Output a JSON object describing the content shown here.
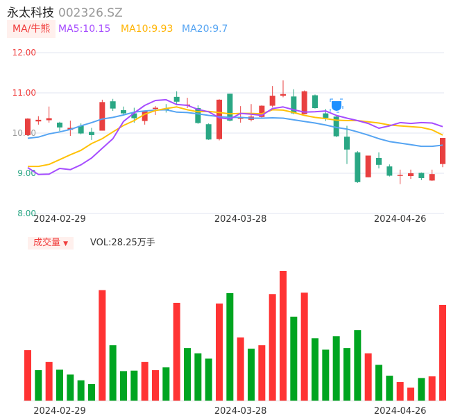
{
  "header": {
    "name": "永太科技",
    "code": "002326.SZ"
  },
  "ma_legend": {
    "tag": "MA/牛熊",
    "ma5": "MA5:10.15",
    "ma10": "MA10:9.93",
    "ma20": "MA20:9.7"
  },
  "volume_legend": {
    "tag": "成交量",
    "arrow": "▼",
    "value": "VOL:28.25万手"
  },
  "colors": {
    "up": "#e84040",
    "down": "#2aa784",
    "vol_up": "#ff3333",
    "vol_down": "#00a521",
    "ma5": "#a64dff",
    "ma10": "#ffc107",
    "ma20": "#55a4f2",
    "grid": "#e1e5f0"
  },
  "marker_icon": "bull-bear-shield-icon",
  "chart_data": {
    "type": "candlestick",
    "ylim": [
      8,
      12
    ],
    "y_ticks": [
      "12.00",
      "11.00",
      "10.00",
      "9.00",
      "8.00"
    ],
    "x_ticks": [
      {
        "index": 3,
        "label": "2024-02-29"
      },
      {
        "index": 20,
        "label": "2024-03-28"
      },
      {
        "index": 35,
        "label": "2024-04-26"
      }
    ],
    "candles": {
      "open": [
        9.95,
        10.29,
        10.32,
        10.26,
        10.08,
        10.18,
        10.03,
        10.06,
        10.79,
        10.57,
        10.49,
        10.3,
        10.6,
        10.61,
        10.9,
        10.68,
        10.62,
        10.22,
        9.85,
        10.98,
        10.36,
        10.33,
        10.4,
        10.68,
        10.93,
        10.91,
        10.47,
        10.94,
        10.49,
        10.41,
        9.91,
        9.52,
        8.9,
        9.38,
        9.17,
        8.94,
        8.93,
        9.01,
        8.82,
        9.23
      ],
      "close": [
        10.36,
        10.33,
        10.37,
        10.14,
        10.13,
        9.99,
        9.95,
        10.77,
        10.61,
        10.49,
        10.37,
        10.55,
        10.63,
        10.56,
        10.78,
        10.71,
        10.25,
        9.84,
        10.83,
        10.31,
        10.38,
        10.41,
        10.68,
        10.93,
        10.97,
        10.49,
        11.04,
        10.62,
        10.38,
        9.92,
        9.59,
        8.78,
        9.44,
        9.21,
        8.94,
        8.96,
        9.0,
        8.88,
        8.98,
        9.88
      ],
      "high": [
        10.37,
        10.42,
        10.66,
        10.28,
        10.31,
        10.24,
        10.13,
        10.83,
        10.85,
        10.66,
        10.63,
        10.55,
        10.67,
        10.72,
        11.04,
        10.88,
        10.69,
        10.24,
        10.84,
        10.98,
        10.67,
        10.72,
        10.69,
        11.17,
        11.31,
        11.09,
        11.06,
        10.96,
        10.6,
        10.42,
        10.18,
        9.55,
        9.44,
        9.52,
        9.22,
        9.09,
        9.09,
        9.02,
        9.09,
        9.88
      ],
      "low": [
        9.94,
        10.21,
        10.26,
        10.05,
        9.93,
        9.97,
        9.83,
        10.06,
        10.55,
        10.45,
        10.26,
        10.21,
        10.45,
        10.51,
        10.69,
        10.62,
        10.23,
        9.83,
        9.82,
        10.29,
        10.26,
        10.29,
        10.38,
        10.64,
        10.89,
        10.47,
        10.47,
        10.61,
        10.3,
        9.9,
        9.23,
        8.76,
        8.9,
        9.12,
        8.92,
        8.73,
        8.86,
        8.83,
        8.81,
        9.15
      ]
    },
    "ma5": [
      9.14,
      8.97,
      8.98,
      9.12,
      9.09,
      9.21,
      9.38,
      9.62,
      9.86,
      10.29,
      10.5,
      10.69,
      10.81,
      10.83,
      10.71,
      10.69,
      10.59,
      10.53,
      10.38,
      10.35,
      10.49,
      10.47,
      10.44,
      10.61,
      10.65,
      10.58,
      10.52,
      10.53,
      10.55,
      10.44,
      10.37,
      10.31,
      10.24,
      10.12,
      10.18,
      10.26,
      10.24,
      10.26,
      10.25,
      10.16
    ],
    "ma10": [
      9.17,
      9.17,
      9.22,
      9.34,
      9.46,
      9.57,
      9.74,
      9.86,
      10.03,
      10.19,
      10.31,
      10.47,
      10.56,
      10.61,
      10.65,
      10.58,
      10.53,
      10.54,
      10.51,
      10.48,
      10.49,
      10.49,
      10.48,
      10.58,
      10.57,
      10.51,
      10.44,
      10.39,
      10.36,
      10.32,
      10.31,
      10.31,
      10.28,
      10.25,
      10.2,
      10.18,
      10.16,
      10.14,
      10.08,
      9.95
    ],
    "ma20": [
      9.87,
      9.9,
      9.98,
      10.03,
      10.09,
      10.18,
      10.26,
      10.35,
      10.39,
      10.45,
      10.52,
      10.55,
      10.57,
      10.58,
      10.52,
      10.51,
      10.48,
      10.44,
      10.41,
      10.39,
      10.39,
      10.37,
      10.37,
      10.38,
      10.37,
      10.33,
      10.29,
      10.25,
      10.2,
      10.14,
      10.1,
      10.03,
      9.95,
      9.86,
      9.79,
      9.75,
      9.71,
      9.67,
      9.67,
      9.7
    ],
    "volume_unit": "万手",
    "volume": [
      14.91,
      8.99,
      11.44,
      9.12,
      7.69,
      5.99,
      4.9,
      32.61,
      16.34,
      8.71,
      8.85,
      11.44,
      8.99,
      9.8,
      28.86,
      15.52,
      13.95,
      12.39,
      28.66,
      31.72,
      18.65,
      15.32,
      16.34,
      31.45,
      38.26,
      24.78,
      31.86,
      18.38,
      15.04,
      18.99,
      15.52,
      20.83,
      13.95,
      10.55,
      7.35,
      5.51,
      3.81,
      6.67,
      7.15,
      28.25
    ],
    "volume_direction": [
      "up",
      "down",
      "up",
      "down",
      "down",
      "down",
      "down",
      "up",
      "down",
      "down",
      "down",
      "up",
      "up",
      "down",
      "up",
      "down",
      "down",
      "down",
      "up",
      "down",
      "up",
      "down",
      "up",
      "up",
      "up",
      "down",
      "up",
      "down",
      "down",
      "down",
      "down",
      "down",
      "up",
      "down",
      "down",
      "up",
      "up",
      "down",
      "up",
      "up"
    ]
  }
}
